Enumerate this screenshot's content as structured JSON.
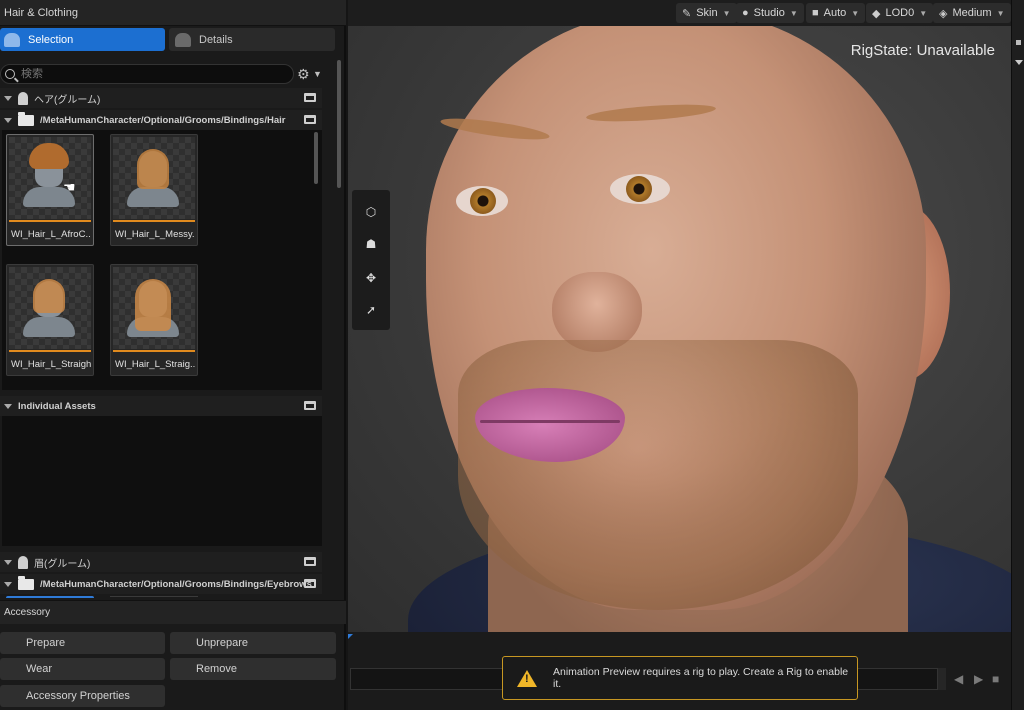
{
  "left_panel": {
    "title": "Hair & Clothing",
    "tabs": [
      {
        "label": "Selection",
        "active": true
      },
      {
        "label": "Details",
        "active": false
      }
    ],
    "search": {
      "placeholder": "検索",
      "value": ""
    },
    "sections": [
      {
        "label": "ヘア(グルーム)"
      },
      {
        "label": "/MetaHumanCharacter/Optional/Grooms/Bindings/Hair"
      },
      {
        "label": "Individual Assets"
      },
      {
        "label": "眉(グルーム)"
      },
      {
        "label": "/MetaHumanCharacter/Optional/Grooms/Bindings/Eyebrows"
      }
    ],
    "hair_items": [
      {
        "label": "WI_Hair_L_AfroC..."
      },
      {
        "label": "WI_Hair_L_Messy..."
      },
      {
        "label": "WI_Hair_L_Straight"
      },
      {
        "label": "WI_Hair_L_Straig..."
      }
    ],
    "accessory": {
      "title": "Accessory",
      "buttons": {
        "prepare": "Prepare",
        "unprepare": "Unprepare",
        "wear": "Wear",
        "remove": "Remove",
        "properties": "Accessory Properties"
      }
    }
  },
  "viewport": {
    "toolbar": {
      "skin": "Skin",
      "studio": "Studio",
      "auto": "Auto",
      "lod": "LOD0",
      "quality": "Medium"
    },
    "rigstate": "RigState: Unavailable"
  },
  "timeline": {
    "warning": "Animation Preview requires a rig to play. Create a Rig to enable it."
  },
  "colors": {
    "accent": "#1c6fd1",
    "warning_border": "#c79722",
    "thumbnail_bar": "#e08a1e"
  },
  "icons": {
    "search": "search-icon",
    "settings": "gear-icon",
    "warning": "warning-icon"
  }
}
